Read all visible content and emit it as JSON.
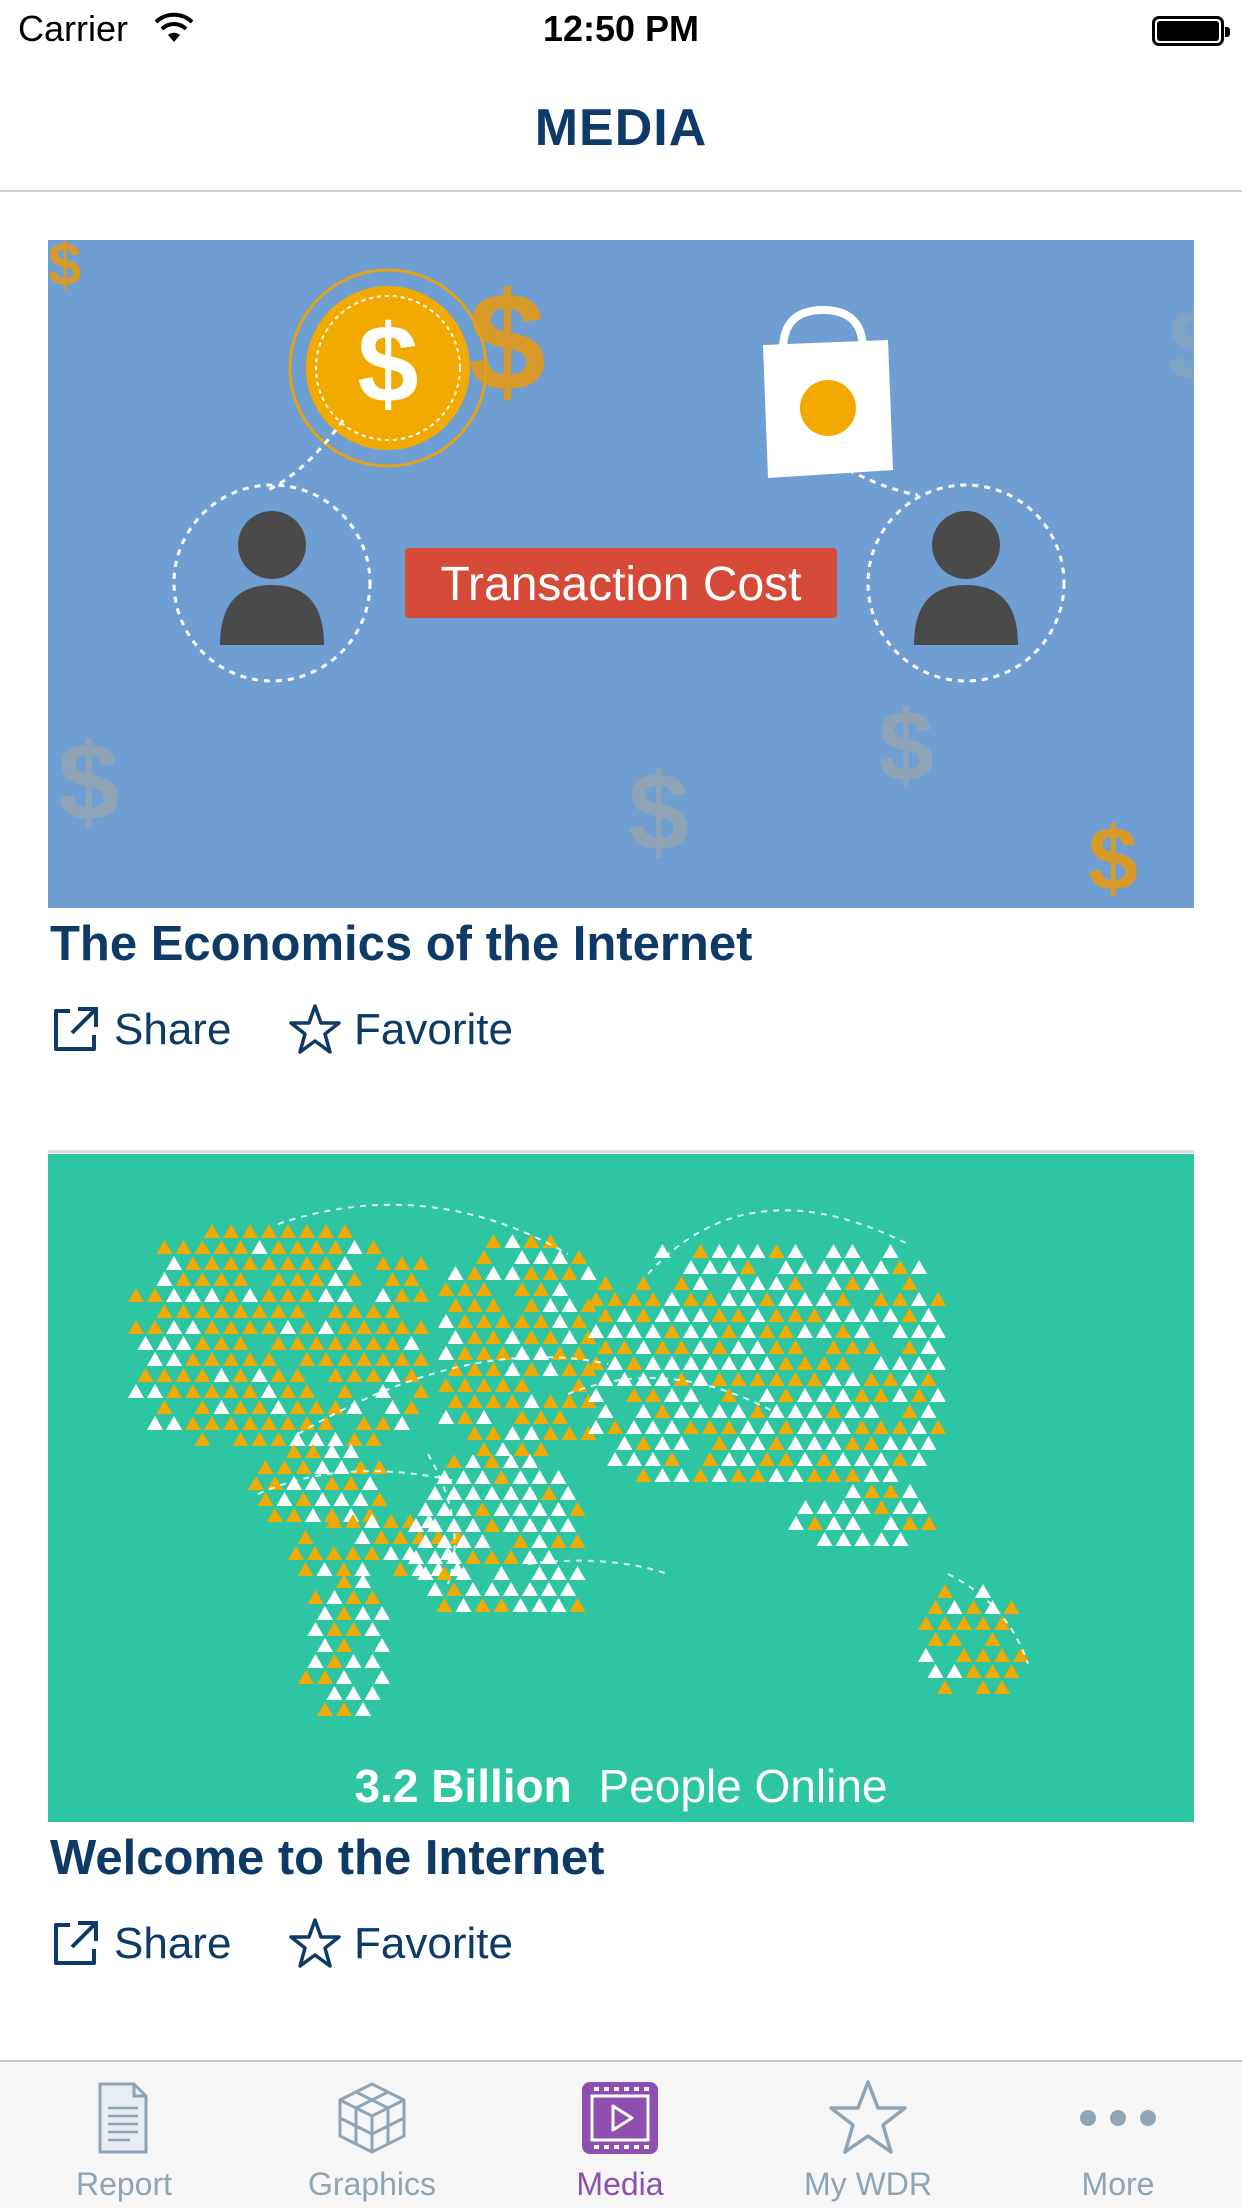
{
  "status_bar": {
    "carrier": "Carrier",
    "time": "12:50 PM"
  },
  "nav": {
    "title": "MEDIA"
  },
  "cards": [
    {
      "title": "The Economics of the Internet",
      "thumbnail_text": "Transaction Cost",
      "thumbnail_icon": "transaction-cost-illustration",
      "share_label": "Share",
      "favorite_label": "Favorite"
    },
    {
      "title": "Welcome to the Internet",
      "thumbnail_text_bold": "3.2 Billion",
      "thumbnail_text_regular": "People Online",
      "thumbnail_icon": "world-map-illustration",
      "share_label": "Share",
      "favorite_label": "Favorite"
    }
  ],
  "tabs": [
    {
      "label": "Report",
      "icon": "document-icon",
      "active": false
    },
    {
      "label": "Graphics",
      "icon": "cube-icon",
      "active": false
    },
    {
      "label": "Media",
      "icon": "play-video-icon",
      "active": true
    },
    {
      "label": "My WDR",
      "icon": "star-icon",
      "active": false
    },
    {
      "label": "More",
      "icon": "more-dots-icon",
      "active": false
    }
  ],
  "colors": {
    "brand": "#0d3a66",
    "active_tab": "#8e4fb0",
    "inactive_tab": "#8fa4b4",
    "card1_bg": "#6f9ed2",
    "card2_bg": "#2ec5a3",
    "accent_orange": "#f2a900",
    "badge_red": "#d64a38"
  }
}
